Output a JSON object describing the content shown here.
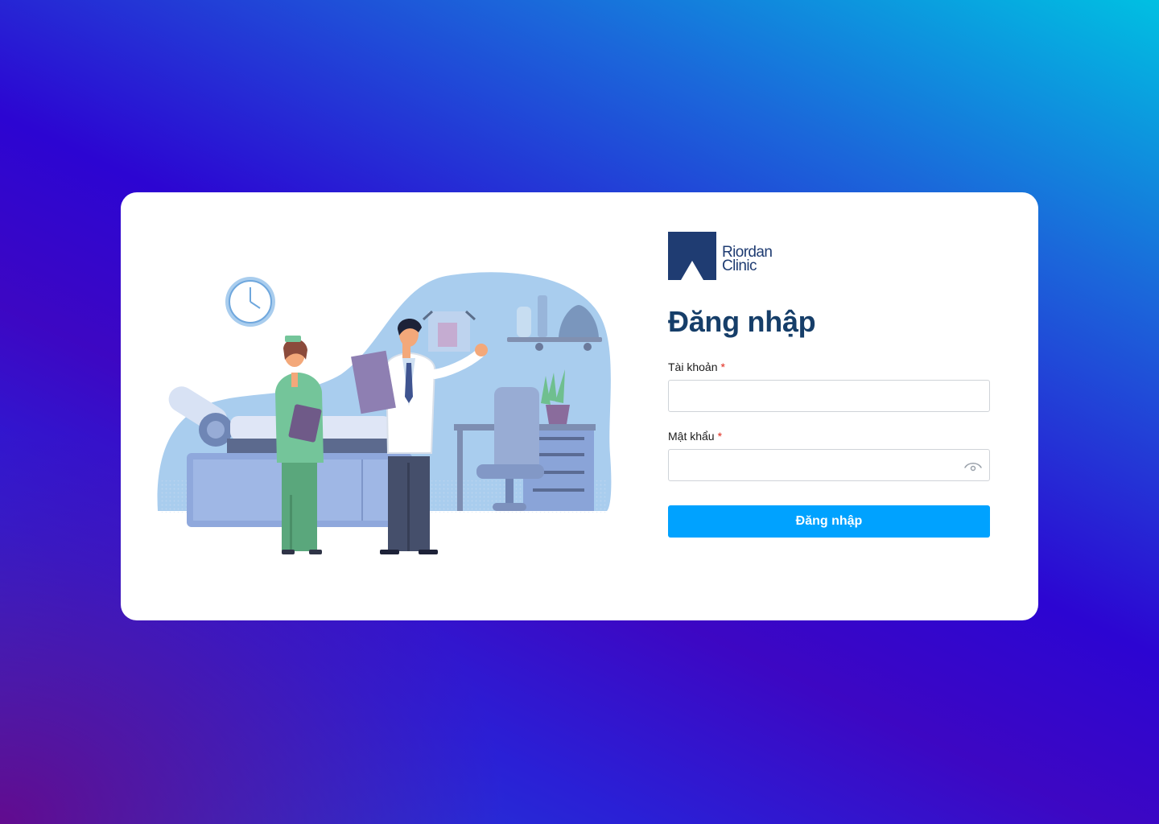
{
  "brand": {
    "line1": "Riordan",
    "line2": "Clinic",
    "color": "#1f3c72"
  },
  "login": {
    "title": "Đăng nhập",
    "account_label": "Tài khoản",
    "password_label": "Mật khẩu",
    "required_mark": "*",
    "account_value": "",
    "password_value": "",
    "submit_label": "Đăng nhập"
  },
  "icons": {
    "password_toggle": "eye-icon",
    "logo": "riordan-logo-icon"
  },
  "colors": {
    "primary_button": "#00a2ff",
    "title": "#163e69",
    "required": "#e0281b"
  }
}
